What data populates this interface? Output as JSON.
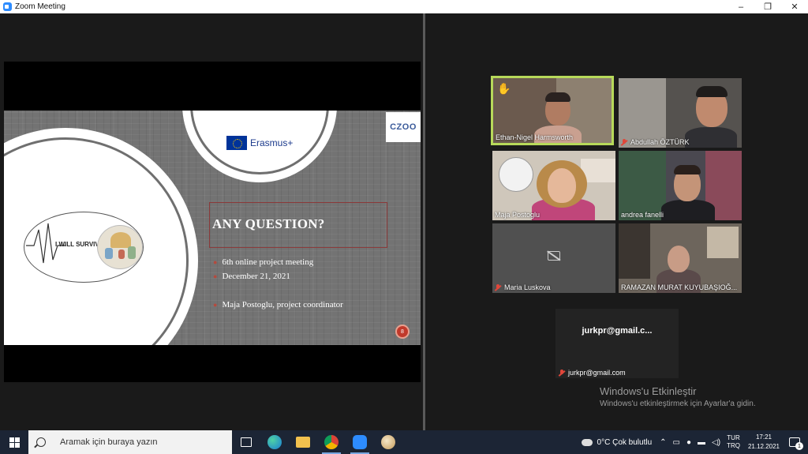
{
  "window": {
    "title": "Zoom Meeting",
    "minimize": "–",
    "maximize": "❐",
    "close": "✕"
  },
  "slide": {
    "erasmus_label": "Erasmus+",
    "logo_label": "CZOO",
    "survive_label": "I WILL SURVIVE!",
    "heading": "ANY QUESTION?",
    "bullets": [
      "6th online project meeting",
      "December 21, 2021",
      "Maja Postoglu, project coordinator"
    ],
    "page_number": "8"
  },
  "participants": [
    {
      "name": "Ethan-Nigel Harmsworth",
      "muted": false,
      "raised_hand": true
    },
    {
      "name": "Abdullah ÖZTÜRK",
      "muted": true
    },
    {
      "name": "Maja Postoglu",
      "muted": false
    },
    {
      "name": "andrea fanelli",
      "muted": false
    },
    {
      "name": "Maria Luskova",
      "muted": true,
      "camera_off": true
    },
    {
      "name": "RAMAZAN MURAT KUYUBAŞIOĞ...",
      "muted": false
    }
  ],
  "email_participant": {
    "display": "jurkpr@gmail.c...",
    "name": "jurkpr@gmail.com",
    "muted": true
  },
  "activation": {
    "title": "Windows'u Etkinleştir",
    "subtitle": "Windows'u etkinleştirmek için Ayarlar'a gidin."
  },
  "taskbar": {
    "search_placeholder": "Aramak için buraya yazın",
    "weather": "0°C  Çok bulutlu",
    "lang_top": "TUR",
    "lang_bottom": "TRQ",
    "time": "17:21",
    "date": "21.12.2021",
    "notifications": "1",
    "icons": [
      "task-view-icon",
      "edge-icon",
      "file-explorer-icon",
      "chrome-icon",
      "zoom-icon",
      "paint-icon"
    ]
  }
}
